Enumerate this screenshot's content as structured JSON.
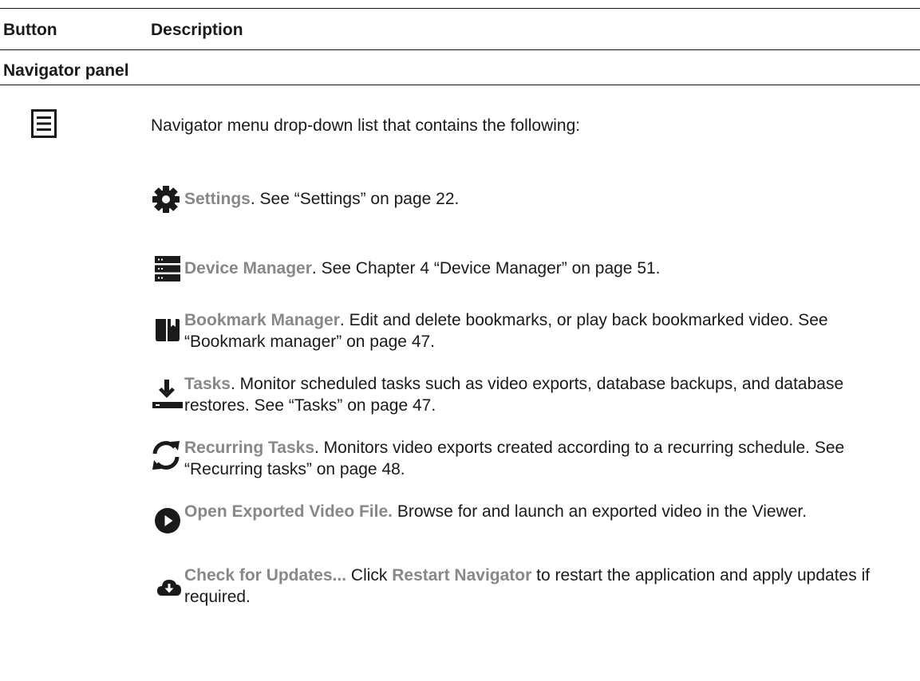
{
  "table": {
    "header": {
      "col_button": "Button",
      "col_description": "Description"
    },
    "section": "Navigator panel",
    "menu_row": {
      "icon": "hamburger-menu-icon",
      "description": "Navigator menu drop-down list that contains the following:"
    },
    "items": [
      {
        "icon": "gear-icon",
        "term": "Settings",
        "text": ". See “Settings” on page 22."
      },
      {
        "icon": "server-icon",
        "term": "Device Manager",
        "text": ". See Chapter 4 “Device Manager” on page 51."
      },
      {
        "icon": "bookmark-book-icon",
        "term": "Bookmark Manager",
        "text": ". Edit and delete bookmarks, or play back bookmarked video. See “Bookmark manager” on page 47."
      },
      {
        "icon": "download-icon",
        "term": "Tasks",
        "text": ". Monitor scheduled tasks such as video exports, database backups, and database restores. See “Tasks” on page 47."
      },
      {
        "icon": "refresh-icon",
        "term": "Recurring Tasks",
        "text": ". Monitors video exports created according to a recurring schedule. See “Recurring tasks” on page 48."
      },
      {
        "icon": "play-circle-icon",
        "term": "Open Exported Video File.",
        "text": " Browse for and launch an exported video in the Viewer."
      },
      {
        "icon": "cloud-download-icon",
        "term": "Check for Updates...",
        "text": " Click ",
        "term2": "Restart Navigator",
        "text2": " to restart the application and apply updates if required."
      }
    ]
  },
  "colors": {
    "text": "#1a1a1a",
    "term": "#888888",
    "icon": "#1a1a1a",
    "rule": "#111111"
  }
}
